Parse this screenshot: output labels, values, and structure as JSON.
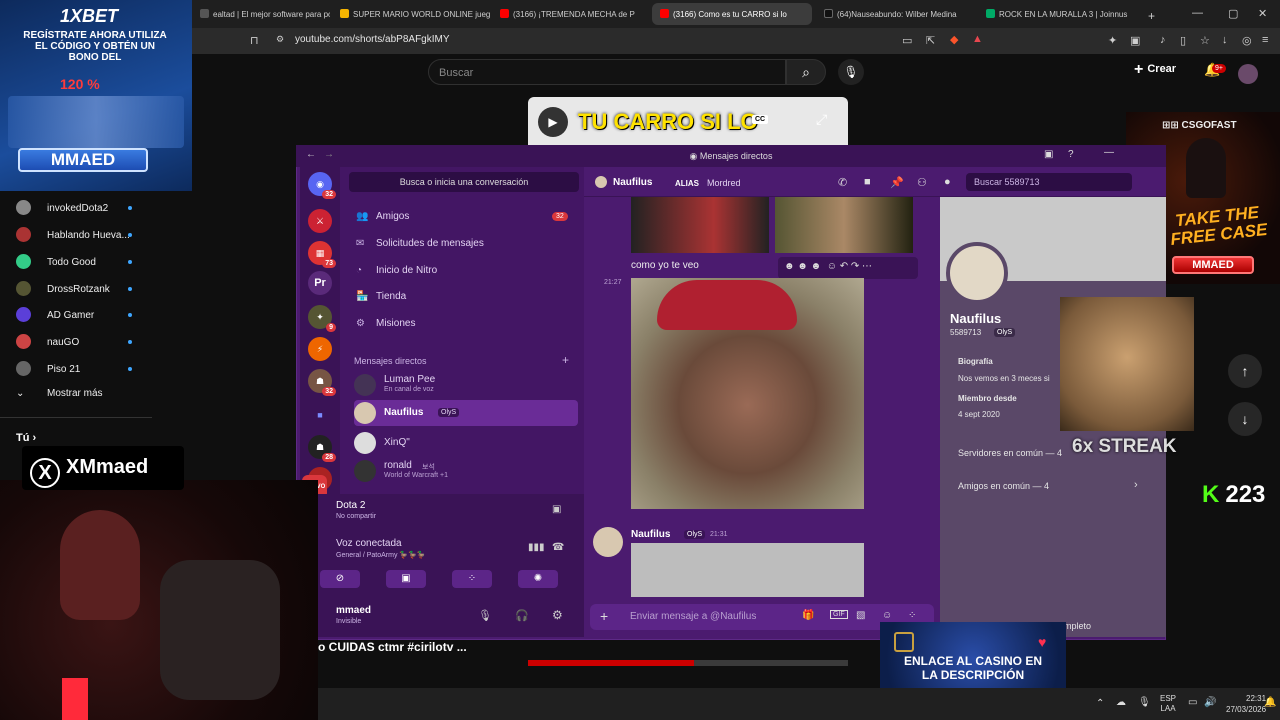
{
  "browser": {
    "tabs": [
      {
        "label": "ealtad | El mejor software para pot",
        "active": false
      },
      {
        "label": "SUPER MARIO WORLD ONLINE jueg",
        "active": false
      },
      {
        "label": "(3166) ¡TREMENDA MECHA de P",
        "active": false
      },
      {
        "label": "(3166) Como es tu CARRO si lo",
        "active": true
      },
      {
        "label": "(64)Nauseabundo: Wilber Medina",
        "active": false
      },
      {
        "label": "ROCK EN LA MURALLA 3 | Joinnus",
        "active": false
      }
    ],
    "url": "youtube.com/shorts/abP8AFgkIMY"
  },
  "youtube": {
    "search_placeholder": "Buscar",
    "create_label": "Crear",
    "notif_badge": "9+",
    "channels": [
      "invokedDota2",
      "Hablando Hueva...",
      "Todo Good",
      "DrossRotzank",
      "AD Gamer",
      "nauGO",
      "Piso 21"
    ],
    "show_more": "Mostrar más",
    "you_label": "Tú",
    "video_overlay_text": "TU CARRO SI LO",
    "video_caption": "o CUIDAS ctmr #cirilotv ..."
  },
  "ads": {
    "betting": {
      "brand": "1XBET",
      "text": "REGÍSTRATE AHORA UTILIZA EL CÓDIGO Y OBTÉN UN BONO DEL",
      "percent": "120 %",
      "code": "MMAED"
    },
    "case": {
      "brand": "CSGOFAST",
      "headline": "TAKE THE FREE CASE",
      "code": "MMAED"
    },
    "casino": {
      "text": "ENLACE AL CASINO EN LA DESCRIPCIÓN"
    },
    "streak": "6x STREAK",
    "kick_count": "223",
    "x_handle": "XMmaed"
  },
  "discord": {
    "window_title": "Mensajes directos",
    "dm_search": "Busca o inicia una conversación",
    "nav": [
      {
        "icon": "friends-icon",
        "label": "Amigos",
        "badge": "32"
      },
      {
        "icon": "requests-icon",
        "label": "Solicitudes de mensajes",
        "badge": ""
      },
      {
        "icon": "nitro-icon",
        "label": "Inicio de Nitro",
        "badge": ""
      },
      {
        "icon": "shop-icon",
        "label": "Tienda",
        "badge": ""
      },
      {
        "icon": "quests-icon",
        "label": "Misiones",
        "badge": ""
      }
    ],
    "dm_header": "Mensajes directos",
    "dms": [
      {
        "name": "Luman Pee",
        "sub": "En canal de voz",
        "tag": ""
      },
      {
        "name": "Naufilus",
        "sub": "",
        "tag": "OlyS"
      },
      {
        "name": "XinQ\"",
        "sub": "",
        "tag": ""
      },
      {
        "name": "ronald",
        "sub": "World of Warcraft +1",
        "tag": "보석"
      }
    ],
    "guild_badges": [
      "32",
      "73",
      "9",
      "32",
      "28"
    ],
    "guild_label_pr": "Pr",
    "guild_new": "NUEVO",
    "activity": {
      "game": "Dota 2",
      "sub": "No compartir"
    },
    "voice": {
      "status": "Voz conectada",
      "channel": "General / PatoArmy 🦆🦆🦆"
    },
    "user": {
      "name": "mmaed",
      "status": "Invisible"
    },
    "chat_header": {
      "name": "Naufilus",
      "alias_label": "ALIAS",
      "alias": "Mordred",
      "search": "Buscar 5589713"
    },
    "messages": [
      {
        "time": "21:27",
        "text": "como yo te veo"
      },
      {
        "author": "Naufilus",
        "tag": "OlyS",
        "time": "21:31"
      }
    ],
    "composer_placeholder": "Enviar mensaje a @Naufilus",
    "profile": {
      "name": "Naufilus",
      "id": "5589713",
      "tag": "OlyS",
      "bio_label": "Biografía",
      "bio": "Nos vemos en 3 meces si",
      "member_label": "Miembro desde",
      "member_since": "4 sept 2020",
      "servers": "Servidores en común — 4",
      "friends": "Amigos en común — 4",
      "full_profile": "mpleto"
    }
  },
  "taskbar": {
    "lang": "ESP",
    "lang2": "LAA",
    "time": "22:31",
    "date": "27/03/2026"
  }
}
